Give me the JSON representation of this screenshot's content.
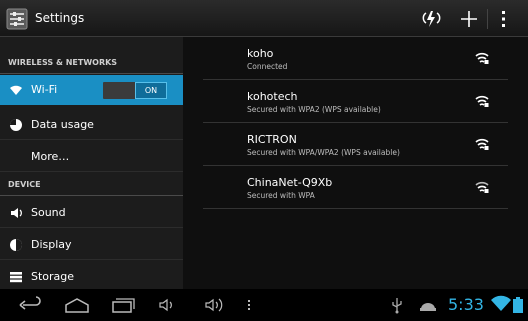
{
  "actionbar": {
    "title": "Settings",
    "icons": [
      "settings-app-icon",
      "wps-push-icon",
      "add-network-icon",
      "overflow-menu-icon"
    ]
  },
  "sidebar": {
    "sections": [
      {
        "header": "WIRELESS & NETWORKS"
      },
      {
        "header": "DEVICE"
      }
    ],
    "items": [
      {
        "label": "Wi-Fi",
        "icon": "wifi-icon",
        "toggle": "ON",
        "selected": true
      },
      {
        "label": "Data usage",
        "icon": "data-usage-icon"
      },
      {
        "label": "More…",
        "icon": ""
      },
      {
        "label": "Sound",
        "icon": "speaker-icon"
      },
      {
        "label": "Display",
        "icon": "display-icon"
      },
      {
        "label": "Storage",
        "icon": "storage-icon"
      }
    ]
  },
  "networks": [
    {
      "ssid": "koho",
      "status": "Connected"
    },
    {
      "ssid": "kohotech",
      "status": "Secured with WPA2 (WPS available)"
    },
    {
      "ssid": "RICTRON",
      "status": "Secured with WPA/WPA2 (WPS available)"
    },
    {
      "ssid": "ChinaNet-Q9Xb",
      "status": "Secured with WPA"
    }
  ],
  "statusbar": {
    "time": "5:33"
  },
  "colors": {
    "accent": "#33b5e5",
    "selected_bg": "#1a8fc4"
  }
}
